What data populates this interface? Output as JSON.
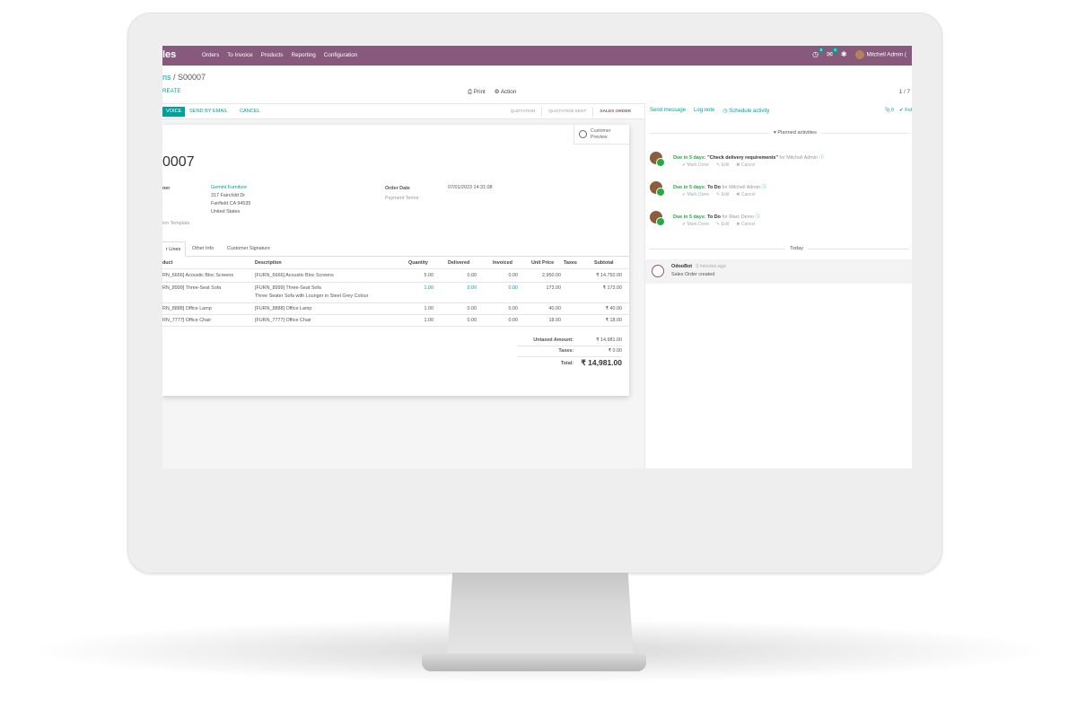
{
  "navbar": {
    "app_name": "les",
    "menu": [
      "Orders",
      "To Invoice",
      "Products",
      "Reporting",
      "Configuration"
    ],
    "activity_badge": "5",
    "messages_badge": "6",
    "user": "Mitchell Admin (",
    "icons": {
      "activity": "clock-icon",
      "messages": "chat-icon",
      "debug": "bug-icon"
    }
  },
  "breadcrumb": {
    "parent": "ns",
    "separator": " / ",
    "current": "S00007"
  },
  "control_panel": {
    "create": "REATE",
    "print": "Print",
    "action": "Action",
    "pager": "1 / 7"
  },
  "statusbar": {
    "invoice_btn": "VOICE",
    "send_email": "SEND BY EMAIL",
    "cancel": "CANCEL",
    "stages": [
      "QUOTATION",
      "QUOTATION SENT",
      "SALES ORDER"
    ],
    "active_stage": "SALES ORDER"
  },
  "sheet": {
    "preview_label": "Customer Preview",
    "order_name": "0007",
    "customer_label": "ner",
    "customer_name": "Gemini Furniture",
    "address_lines": [
      "317 Fairchild Dr",
      "Fairfield CA 94535",
      "United States"
    ],
    "template_label": "ion Template",
    "order_date_label": "Order Date",
    "order_date": "07/01/2023 14:31:08",
    "payment_terms_label": "Payment Terms"
  },
  "tabs": [
    "r Lines",
    "Other Info",
    "Customer Signature"
  ],
  "order_lines": {
    "headers": [
      "duct",
      "Description",
      "Quantity",
      "Delivered",
      "Invoiced",
      "Unit Price",
      "Taxes",
      "Subtotal"
    ],
    "rows": [
      {
        "product": "RN_6666] Acoustic Bloc Screens",
        "description": "[FURN_6666] Acoustic Bloc Screens",
        "description2": "",
        "quantity": "5.00",
        "delivered": "0.00",
        "invoiced": "0.00",
        "unit_price": "2,950.00",
        "taxes": "",
        "subtotal": "₹ 14,750.00",
        "highlight": false
      },
      {
        "product": "RN_8999] Three-Seat Sofa",
        "description": "[FURN_8999] Three-Seat Sofa",
        "description2": "Three Seater Sofa with Lounger in Steel Grey Colour",
        "quantity": "1.00",
        "delivered": "0.00",
        "invoiced": "0.00",
        "unit_price": "173.00",
        "taxes": "",
        "subtotal": "₹ 173.00",
        "highlight": true
      },
      {
        "product": "RN_8888] Office Lamp",
        "description": "[FURN_8888] Office Lamp",
        "description2": "",
        "quantity": "1.00",
        "delivered": "0.00",
        "invoiced": "0.00",
        "unit_price": "40.00",
        "taxes": "",
        "subtotal": "₹ 40.00",
        "highlight": false
      },
      {
        "product": "RN_7777] Office Chair",
        "description": "[FURN_7777] Office Chair",
        "description2": "",
        "quantity": "1.00",
        "delivered": "0.00",
        "invoiced": "0.00",
        "unit_price": "18.00",
        "taxes": "",
        "subtotal": "₹ 18.00",
        "highlight": false
      }
    ]
  },
  "totals": {
    "untaxed_label": "Untaxed Amount:",
    "untaxed": "₹ 14,981.00",
    "taxes_label": "Taxes:",
    "taxes": "₹ 0.00",
    "total_label": "Total:",
    "total": "₹ 14,981.00"
  },
  "chatter": {
    "send_message": "Send message",
    "log_note": "Log note",
    "schedule_activity": "Schedule activity",
    "attachments": "0",
    "follow": "Fol",
    "planned_label": "Planned activities",
    "activities": [
      {
        "due": "Due in 5 days:",
        "title": "\"Check delivery requirements\"",
        "for_label": "for",
        "assignee": "Mitchell Admin"
      },
      {
        "due": "Due in 5 days:",
        "title": "To Do",
        "for_label": "for",
        "assignee": "Mitchell Admin"
      },
      {
        "due": "Due in 5 days:",
        "title": "To Do",
        "for_label": "for",
        "assignee": "Marc Demo"
      }
    ],
    "activity_ops": {
      "mark_done": "Mark Done",
      "edit": "Edit",
      "cancel": "Cancel"
    },
    "today_label": "Today",
    "message": {
      "author": "OdooBot",
      "date": "3 minutes ago",
      "body": "Sales Order created"
    }
  },
  "colors": {
    "brand": "#875a7b",
    "accent": "#00a09d",
    "success": "#28a745"
  }
}
